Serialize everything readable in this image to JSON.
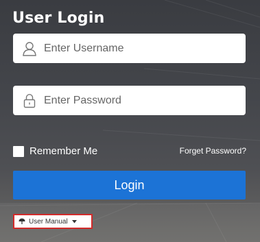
{
  "login": {
    "title": "User Login",
    "username": {
      "placeholder": "Enter Username",
      "value": ""
    },
    "password": {
      "placeholder": "Enter Password",
      "value": ""
    },
    "remember_label": "Remember Me",
    "remember_checked": false,
    "forget_link": "Forget Password?",
    "login_button": "Login",
    "manual_label": "User Manual"
  },
  "icons": {
    "username": "user-icon",
    "password": "lock-icon",
    "manual": "umbrella-icon",
    "manual_dropdown": "caret-down-icon"
  },
  "colors": {
    "login_button": "#1c73d6",
    "manual_border": "#d32a2a"
  }
}
